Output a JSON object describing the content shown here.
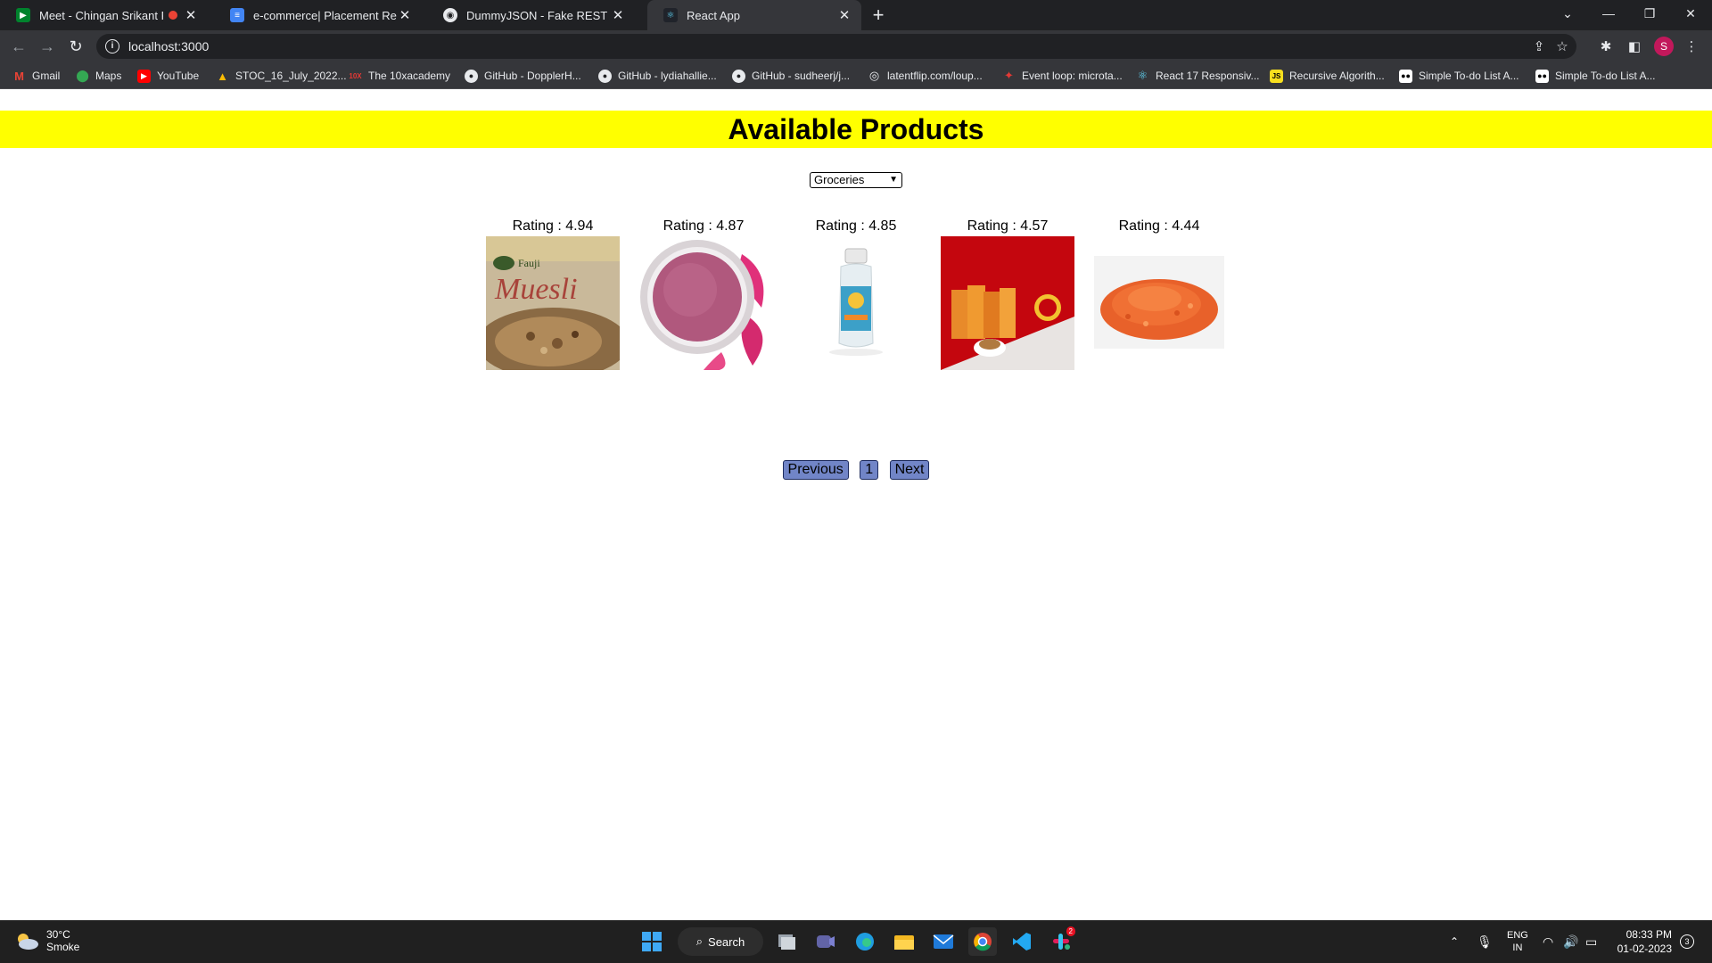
{
  "browser": {
    "tabs": [
      {
        "title": "Meet - Chingan Srikant Prak",
        "icon": "google-meet-icon",
        "recording": true
      },
      {
        "title": "e-commerce| Placement Readine",
        "icon": "google-docs-icon"
      },
      {
        "title": "DummyJSON - Fake REST API of",
        "icon": "dummyjson-icon"
      },
      {
        "title": "React App",
        "icon": "react-icon",
        "active": true
      }
    ],
    "new_tab_label": "+",
    "address": "localhost:3000",
    "avatar_letter": "S",
    "bookmarks": [
      {
        "label": "Gmail",
        "icon": "gmail-icon"
      },
      {
        "label": "Maps",
        "icon": "maps-icon"
      },
      {
        "label": "YouTube",
        "icon": "youtube-icon"
      },
      {
        "label": "STOC_16_July_2022...",
        "icon": "drive-icon"
      },
      {
        "label": "The 10xacademy",
        "icon": "tenx-icon"
      },
      {
        "label": "GitHub - DopplerH...",
        "icon": "github-icon"
      },
      {
        "label": "GitHub - lydiahallie...",
        "icon": "github-icon"
      },
      {
        "label": "GitHub - sudheerj/j...",
        "icon": "github-icon"
      },
      {
        "label": "latentflip.com/loup...",
        "icon": "globe-icon"
      },
      {
        "label": "Event loop: microta...",
        "icon": "event-loop-icon"
      },
      {
        "label": "React 17 Responsiv...",
        "icon": "react-icon"
      },
      {
        "label": "Recursive Algorith...",
        "icon": "js-icon"
      },
      {
        "label": "Simple To-do List A...",
        "icon": "medium-icon"
      },
      {
        "label": "Simple To-do List A...",
        "icon": "medium-icon"
      }
    ]
  },
  "page": {
    "title": "Available Products",
    "category_select": {
      "selected": "Groceries"
    },
    "products": [
      {
        "rating_text": "Rating : 4.94",
        "rating": 4.94,
        "image": "muesli-box"
      },
      {
        "rating_text": "Rating : 4.87",
        "rating": 4.87,
        "image": "rose-powder"
      },
      {
        "rating_text": "Rating : 4.85",
        "rating": 4.85,
        "image": "orange-essence-bottle"
      },
      {
        "rating_text": "Rating : 4.57",
        "rating": 4.57,
        "image": "dry-fruits-pack"
      },
      {
        "rating_text": "Rating : 4.44",
        "rating": 4.44,
        "image": "red-lentils"
      }
    ],
    "pagination": {
      "previous": "Previous",
      "current": "1",
      "next": "Next"
    }
  },
  "taskbar": {
    "weather": {
      "temp": "30°C",
      "condition": "Smoke"
    },
    "search_label": "Search",
    "lang": "ENG",
    "region": "IN",
    "time": "08:33 PM",
    "date": "01-02-2023",
    "notification_count": "3",
    "slack_badge": "2"
  },
  "colors": {
    "banner": "#ffff00",
    "pager_button": "#7185c7",
    "chrome_dark": "#202124",
    "chrome_toolbar": "#35363a"
  }
}
